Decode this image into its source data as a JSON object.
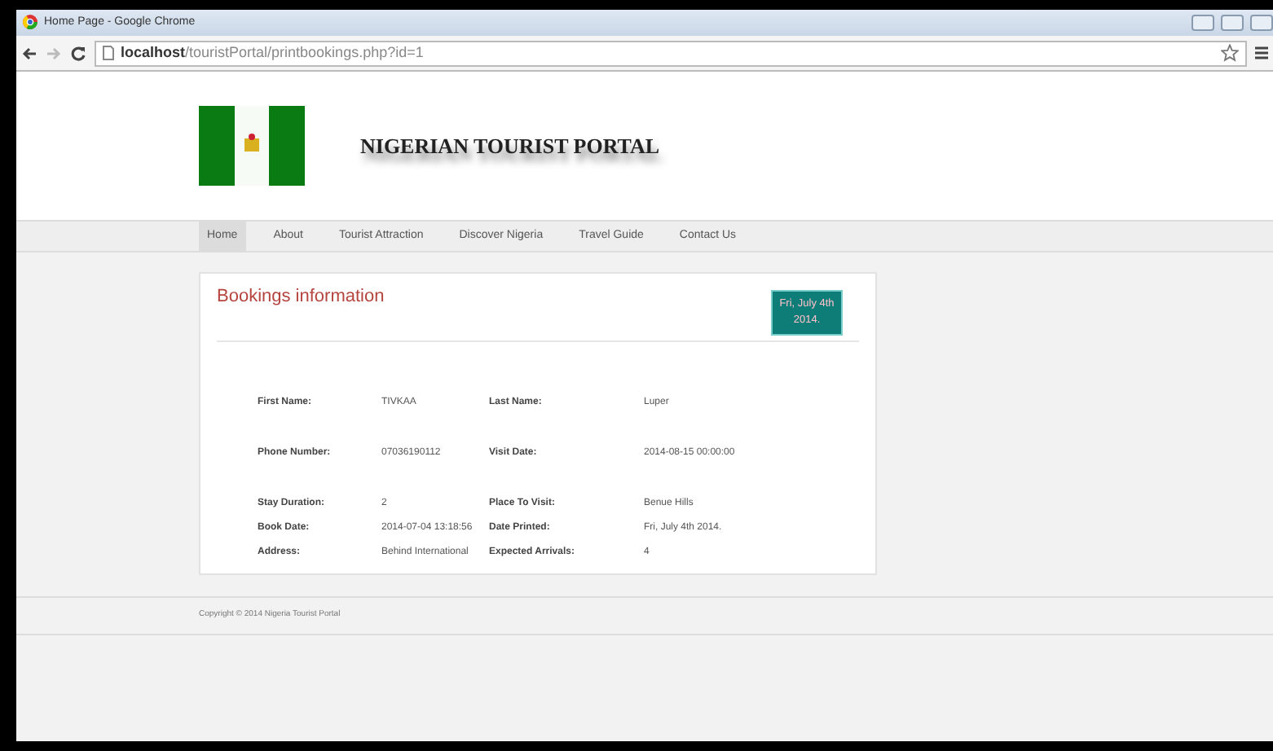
{
  "window": {
    "title": "Home Page - Google Chrome"
  },
  "browser": {
    "url": "**localhost**/touristPortal/printbookings.php?id=1"
  },
  "site": {
    "title": "NIGERIAN TOURIST PORTAL"
  },
  "nav": [
    {
      "label": "Home",
      "selected": true
    },
    {
      "label": "About",
      "selected": false
    },
    {
      "label": "Tourist Attraction",
      "selected": false
    },
    {
      "label": "Discover Nigeria",
      "selected": false
    },
    {
      "label": "Travel Guide",
      "selected": false
    },
    {
      "label": "Contact Us",
      "selected": false
    }
  ],
  "card": {
    "title": "Bookings information",
    "date_badge": "Fri, July 4th 2014.",
    "groups": [
      {
        "rows": [
          {
            "fields": [
              {
                "label": "First Name:",
                "value": "TIVKAA"
              },
              {
                "label": "Last Name:",
                "value": "Luper"
              }
            ]
          }
        ]
      },
      {
        "rows": [
          {
            "fields": [
              {
                "label": "Phone Number:",
                "value": "07036190112"
              },
              {
                "label": "Visit Date:",
                "value": "2014-08-15 00:00:00"
              }
            ]
          }
        ]
      },
      {
        "rows": [
          {
            "fields": [
              {
                "label": "Stay Duration:",
                "value": "2"
              },
              {
                "label": "Place To Visit:",
                "value": "Benue Hills"
              }
            ]
          },
          {
            "fields": [
              {
                "label": "Book Date:",
                "value": "2014-07-04 13:18:56"
              },
              {
                "label": "Date Printed:",
                "value": "Fri, July 4th 2014."
              }
            ]
          },
          {
            "fields": [
              {
                "label": "Address:",
                "value": "Behind International"
              },
              {
                "label": "Expected Arrivals:",
                "value": "4"
              }
            ]
          }
        ]
      }
    ]
  },
  "footer": {
    "text": "Copyright © 2014 Nigeria Tourist Portal"
  }
}
